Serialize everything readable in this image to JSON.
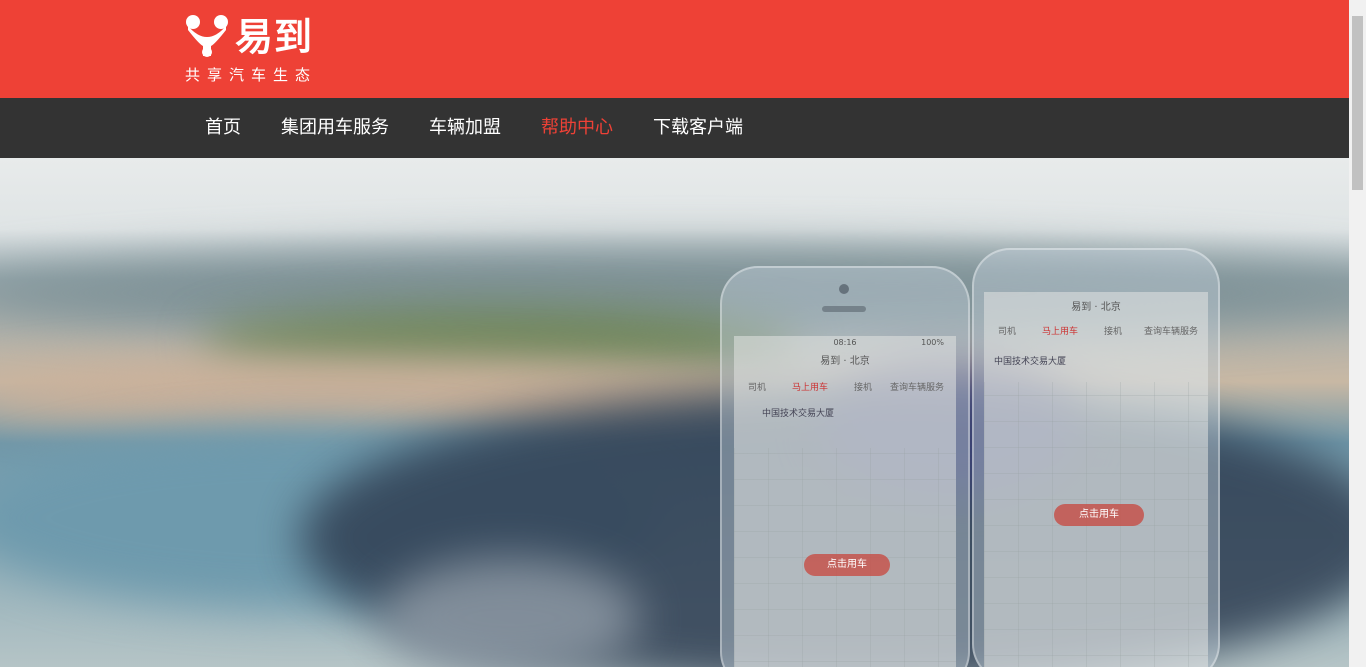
{
  "brand": {
    "logo_icon": "y-logo-icon",
    "name": "易到",
    "slogan": "共享汽车生态",
    "color": "#ee4136"
  },
  "nav": {
    "items": [
      {
        "label": "首页"
      },
      {
        "label": "集团用车服务"
      },
      {
        "label": "车辆加盟"
      },
      {
        "label": "帮助中心",
        "active": true
      },
      {
        "label": "下载客户端"
      }
    ],
    "background": "#333333",
    "active_color": "#ee4136"
  },
  "hero": {
    "phone_front": {
      "status_time": "08:16",
      "status_battery": "100%",
      "title": "易到 · 北京",
      "tabs": [
        "司机",
        "马上用车",
        "接机",
        "查询车辆服务"
      ],
      "address": "中国技术交易大厦",
      "cta": "点击用车"
    },
    "phone_back": {
      "title": "易到 · 北京",
      "tabs": [
        "司机",
        "马上用车",
        "接机",
        "查询车辆服务"
      ],
      "address": "中国技术交易大厦",
      "cta": "点击用车"
    }
  }
}
